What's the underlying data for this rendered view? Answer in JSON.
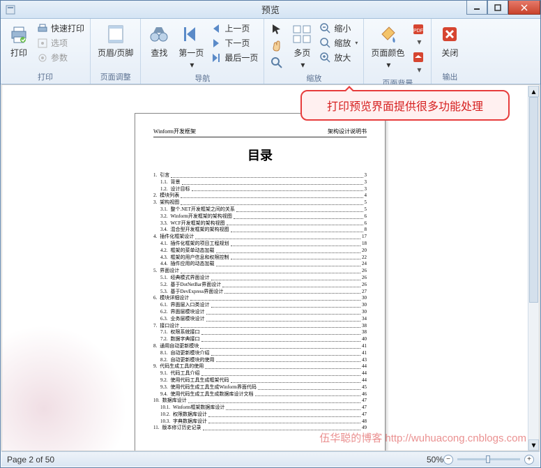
{
  "window": {
    "title": "预览"
  },
  "ribbon": {
    "groups": {
      "print": {
        "label": "打印",
        "print": "打印",
        "quick_print": "快速打印",
        "options": "选项",
        "params": "参数"
      },
      "page_adjust": {
        "label": "页面调整",
        "header_footer": "页眉/页脚"
      },
      "navigation": {
        "label": "导航",
        "find": "查找",
        "first_page": "第一页",
        "prev_page": "上一页",
        "next_page": "下一页",
        "last_page": "最后一页"
      },
      "zoom": {
        "label": "缩放",
        "multi_page": "多页",
        "zoom_out": "缩小",
        "zoom": "缩放",
        "zoom_in": "放大"
      },
      "page_bg": {
        "label": "页面背景",
        "page_color": "页面颜色"
      },
      "output": {
        "label": "输出",
        "close": "关闭"
      }
    }
  },
  "callout": "打印预览界面提供很多功能处理",
  "document": {
    "header_left": "Winform开发框架",
    "header_right": "架构设计说明书",
    "title": "目录",
    "toc": [
      {
        "n": "1.",
        "t": "引言",
        "p": "3",
        "l": 1
      },
      {
        "n": "1.1.",
        "t": "背景",
        "p": "3",
        "l": 2
      },
      {
        "n": "1.2.",
        "t": "设计目标",
        "p": "3",
        "l": 2
      },
      {
        "n": "2.",
        "t": "模块列表",
        "p": "4",
        "l": 1
      },
      {
        "n": "3.",
        "t": "架构视图",
        "p": "5",
        "l": 1
      },
      {
        "n": "3.1.",
        "t": "整个.NET开发框架之间的关系",
        "p": "5",
        "l": 2
      },
      {
        "n": "3.2.",
        "t": "Winform开发框架的架构视图",
        "p": "6",
        "l": 2
      },
      {
        "n": "3.3.",
        "t": "WCF开发框架的架构视图",
        "p": "6",
        "l": 2
      },
      {
        "n": "3.4.",
        "t": "混合型开发框架的架构视图",
        "p": "8",
        "l": 2
      },
      {
        "n": "4.",
        "t": "插件化框架设计",
        "p": "17",
        "l": 1
      },
      {
        "n": "4.1.",
        "t": "插件化框架的项目工程规划",
        "p": "18",
        "l": 2
      },
      {
        "n": "4.2.",
        "t": "框架的菜单动态加载",
        "p": "20",
        "l": 2
      },
      {
        "n": "4.3.",
        "t": "框架的用户信息和权限控制",
        "p": "22",
        "l": 2
      },
      {
        "n": "4.4.",
        "t": "插件应用的动态加载",
        "p": "24",
        "l": 2
      },
      {
        "n": "5.",
        "t": "界面设计",
        "p": "26",
        "l": 1
      },
      {
        "n": "5.1.",
        "t": "经典模式界面设计",
        "p": "26",
        "l": 2
      },
      {
        "n": "5.2.",
        "t": "基于DotNetBar界面设计",
        "p": "26",
        "l": 2
      },
      {
        "n": "5.3.",
        "t": "基于DevExpress界面设计",
        "p": "27",
        "l": 2
      },
      {
        "n": "6.",
        "t": "模块详细设计",
        "p": "30",
        "l": 1
      },
      {
        "n": "6.1.",
        "t": "界面层入口类设计",
        "p": "30",
        "l": 2
      },
      {
        "n": "6.2.",
        "t": "界面层模块设计",
        "p": "30",
        "l": 2
      },
      {
        "n": "6.3.",
        "t": "业务层模块设计",
        "p": "34",
        "l": 2
      },
      {
        "n": "7.",
        "t": "接口设计",
        "p": "38",
        "l": 1
      },
      {
        "n": "7.1.",
        "t": "权限系统接口",
        "p": "38",
        "l": 2
      },
      {
        "n": "7.2.",
        "t": "数据字典接口",
        "p": "40",
        "l": 2
      },
      {
        "n": "8.",
        "t": "通用自动更新模块",
        "p": "41",
        "l": 1
      },
      {
        "n": "8.1.",
        "t": "自动更新模块介绍",
        "p": "41",
        "l": 2
      },
      {
        "n": "8.2.",
        "t": "自动更新模块的使用",
        "p": "43",
        "l": 2
      },
      {
        "n": "9.",
        "t": "代码生成工具的使用",
        "p": "44",
        "l": 1
      },
      {
        "n": "9.1.",
        "t": "代码工具介绍",
        "p": "44",
        "l": 2
      },
      {
        "n": "9.2.",
        "t": "使用代码工具生成框架代码",
        "p": "44",
        "l": 2
      },
      {
        "n": "9.3.",
        "t": "使用代码生成工具生成Winform界面代码",
        "p": "45",
        "l": 2
      },
      {
        "n": "9.4.",
        "t": "使用代码生成工具生成数据库设计文档",
        "p": "46",
        "l": 2
      },
      {
        "n": "10.",
        "t": "数据库设计",
        "p": "47",
        "l": 1
      },
      {
        "n": "10.1.",
        "t": "Winform框架数据库设计",
        "p": "47",
        "l": 2
      },
      {
        "n": "10.2.",
        "t": "权限数据库设计",
        "p": "47",
        "l": 2
      },
      {
        "n": "10.3.",
        "t": "字典数据库设计",
        "p": "48",
        "l": 2
      },
      {
        "n": "11.",
        "t": "版本修订历史记录",
        "p": "49",
        "l": 1
      }
    ]
  },
  "status": {
    "page_info": "Page 2 of 50",
    "zoom_pct": "50%"
  },
  "watermark": "伍华聪的博客 http://wuhuacong.cnblogs.com"
}
